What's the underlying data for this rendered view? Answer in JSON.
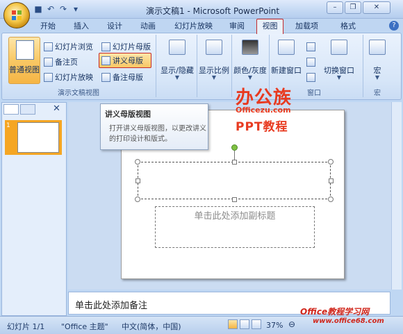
{
  "window": {
    "title": "演示文稿1 - Microsoft PowerPoint"
  },
  "qat": {
    "save_icon": "save-icon",
    "undo_icon": "undo-icon",
    "redo_icon": "redo-icon"
  },
  "tabs": [
    "开始",
    "插入",
    "设计",
    "动画",
    "幻灯片放映",
    "审阅",
    "视图",
    "加载项",
    "格式"
  ],
  "active_tab": "视图",
  "ribbon": {
    "normal_view": "普通视图",
    "slide_sorter": "幻灯片浏览",
    "notes_page": "备注页",
    "slide_show": "幻灯片放映",
    "slide_master": "幻灯片母版",
    "handout_master": "讲义母版",
    "notes_master": "备注母版",
    "group_views": "演示文稿视图",
    "show_hide": "显示/隐藏",
    "zoom": "显示比例",
    "color_gray": "颜色/灰度",
    "new_window": "新建窗口",
    "switch_window": "切换窗口",
    "group_window": "窗口",
    "macro": "宏",
    "group_macro": "宏"
  },
  "tooltip": {
    "title": "讲义母版视图",
    "body": "打开讲义母版视图，以更改讲义的打印设计和版式。"
  },
  "slide": {
    "subtitle_placeholder": "单击此处添加副标题"
  },
  "thumbnail": {
    "number": "1"
  },
  "notes": {
    "placeholder": "单击此处添加备注"
  },
  "watermark": {
    "brand": "办公族",
    "site": "Officezu.com",
    "ppt": "PPT教程",
    "office_site": "Office教程学习网",
    "office_url": "www.office68.com"
  },
  "status": {
    "slide": "幻灯片 1/1",
    "theme": "\"Office 主题\"",
    "language": "中文(简体，中国)",
    "zoom": "37%"
  }
}
